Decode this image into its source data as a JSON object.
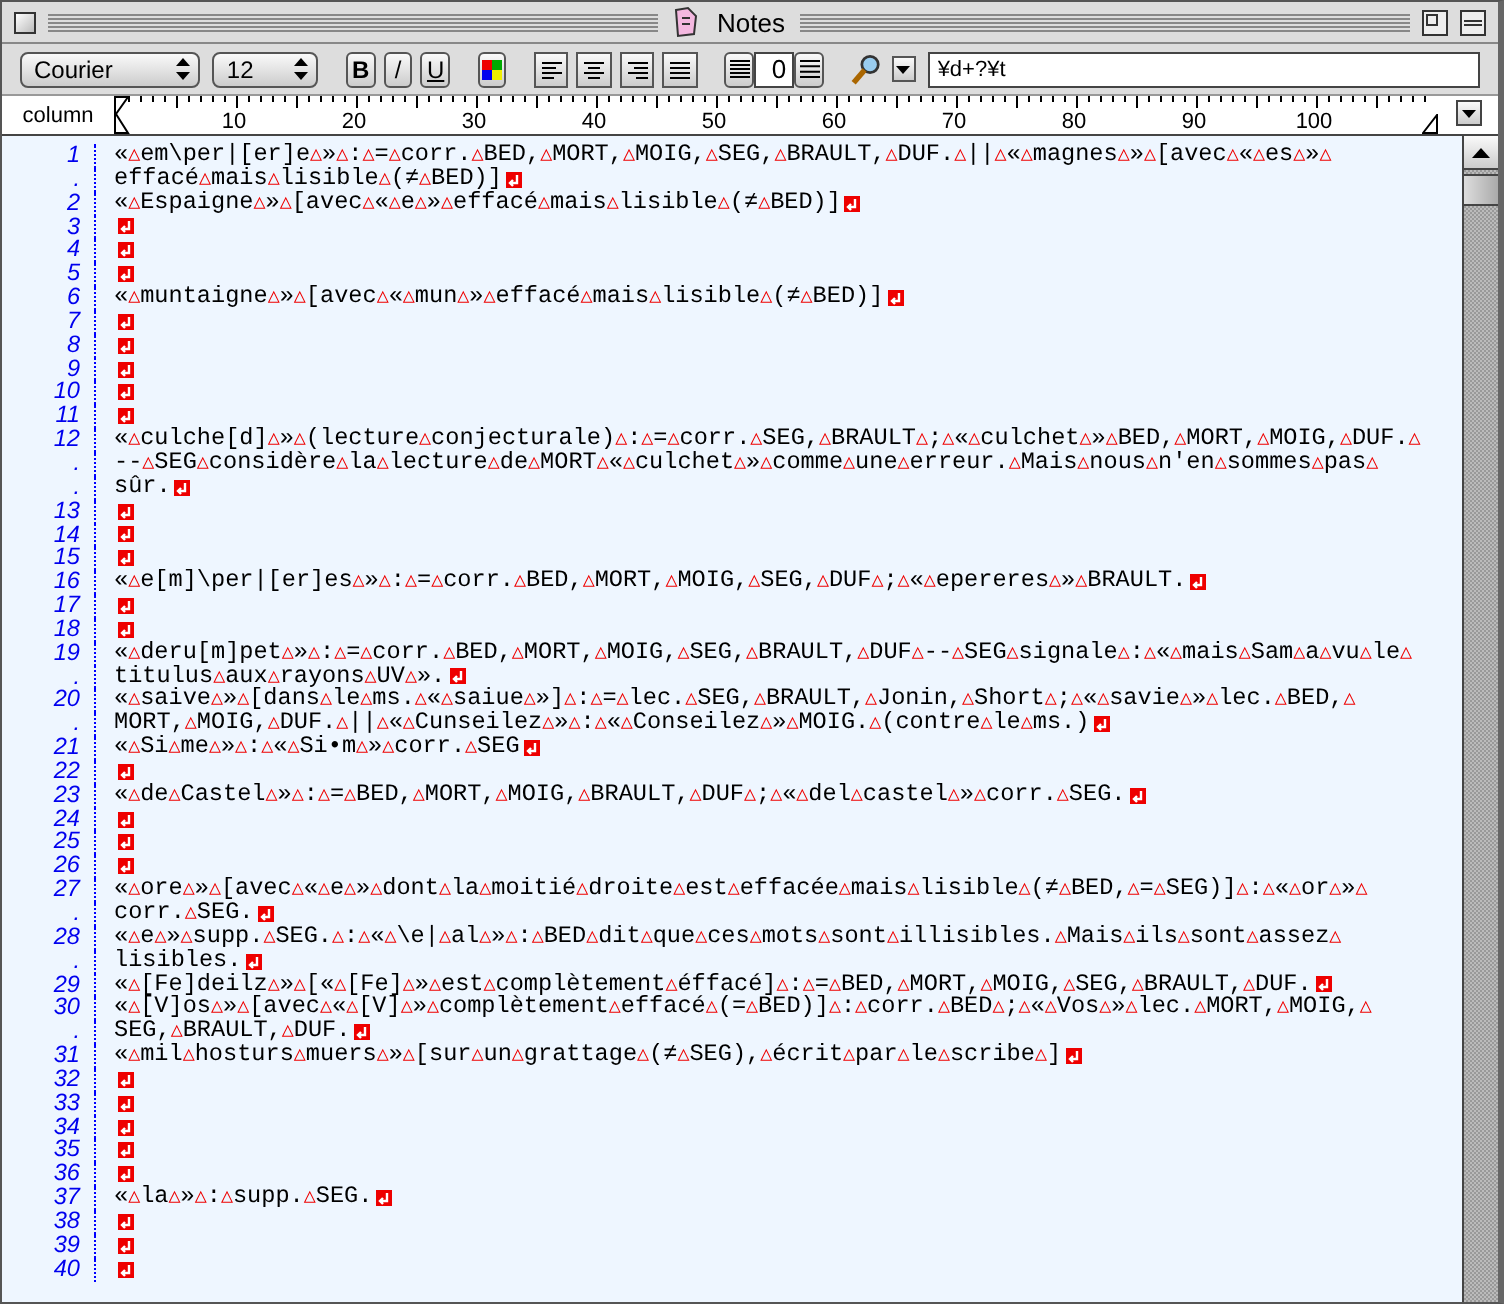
{
  "window": {
    "title": "Notes"
  },
  "toolbar": {
    "font": "Courier",
    "size": "12",
    "style_buttons": [
      {
        "kind": "bold",
        "label": "B"
      },
      {
        "kind": "italic",
        "label": "/"
      },
      {
        "kind": "underline",
        "label": "U"
      }
    ],
    "line_spacing": "0",
    "search": {
      "value": "¥d+?¥t"
    }
  },
  "ruler": {
    "label": "column",
    "ticks": [
      "10",
      "20",
      "30",
      "40",
      "50",
      "60",
      "70",
      "80",
      "90",
      "100"
    ]
  },
  "paragraphs": [
    {
      "lines": [
        {
          "gutter": "1",
          "text": "«△em\\per|[er]e△»△:△=△corr.△BED,△MORT,△MOIG,△SEG,△BRAULT,△DUF.△||△«△magnes△»△[avec△«△es△»△"
        },
        {
          "gutter": ".",
          "text": "effacé△mais△lisible△(≠△BED)]"
        }
      ]
    },
    {
      "lines": [
        {
          "gutter": "2",
          "text": "«△Espaigne△»△[avec△«△e△»△effacé△mais△lisible△(≠△BED)]"
        }
      ]
    },
    {
      "lines": [
        {
          "gutter": "3"
        }
      ]
    },
    {
      "lines": [
        {
          "gutter": "4"
        }
      ]
    },
    {
      "lines": [
        {
          "gutter": "5"
        }
      ]
    },
    {
      "lines": [
        {
          "gutter": "6",
          "text": "«△muntaigne△»△[avec△«△mun△»△effacé△mais△lisible△(≠△BED)]"
        }
      ]
    },
    {
      "lines": [
        {
          "gutter": "7"
        }
      ]
    },
    {
      "lines": [
        {
          "gutter": "8"
        }
      ]
    },
    {
      "lines": [
        {
          "gutter": "9"
        }
      ]
    },
    {
      "lines": [
        {
          "gutter": "10"
        }
      ]
    },
    {
      "lines": [
        {
          "gutter": "11"
        }
      ]
    },
    {
      "lines": [
        {
          "gutter": "12",
          "text": "«△culche[d]△»△(lecture△conjecturale)△:△=△corr.△SEG,△BRAULT△;△«△culchet△»△BED,△MORT,△MOIG,△DUF.△"
        },
        {
          "gutter": ".",
          "text": "--△SEG△considère△la△lecture△de△MORT△«△culchet△»△comme△une△erreur.△Mais△nous△n'en△sommes△pas△"
        },
        {
          "gutter": ".",
          "text": "sûr."
        }
      ]
    },
    {
      "lines": [
        {
          "gutter": "13"
        }
      ]
    },
    {
      "lines": [
        {
          "gutter": "14"
        }
      ]
    },
    {
      "lines": [
        {
          "gutter": "15"
        }
      ]
    },
    {
      "lines": [
        {
          "gutter": "16",
          "text": "«△e[m]\\per|[er]es△»△:△=△corr.△BED,△MORT,△MOIG,△SEG,△DUF△;△«△epereres△»△BRAULT."
        }
      ]
    },
    {
      "lines": [
        {
          "gutter": "17"
        }
      ]
    },
    {
      "lines": [
        {
          "gutter": "18"
        }
      ]
    },
    {
      "lines": [
        {
          "gutter": "19",
          "text": "«△deru[m]pet△»△:△=△corr.△BED,△MORT,△MOIG,△SEG,△BRAULT,△DUF△--△SEG△signale△:△«△mais△Sam△a△vu△le△"
        },
        {
          "gutter": ".",
          "text": "titulus△aux△rayons△UV△»."
        }
      ]
    },
    {
      "lines": [
        {
          "gutter": "20",
          "text": "«△saive△»△[dans△le△ms.△«△saiue△»]△:△=△lec.△SEG,△BRAULT,△Jonin,△Short△;△«△savie△»△lec.△BED,△"
        },
        {
          "gutter": ".",
          "text": "MORT,△MOIG,△DUF.△||△«△Cunseilez△»△:△«△Conseilez△»△MOIG.△(contre△le△ms.)"
        }
      ]
    },
    {
      "lines": [
        {
          "gutter": "21",
          "text": "«△Si△me△»△:△«△Si•m△»△corr.△SEG"
        }
      ]
    },
    {
      "lines": [
        {
          "gutter": "22"
        }
      ]
    },
    {
      "lines": [
        {
          "gutter": "23",
          "text": "«△de△Castel△»△:△=△BED,△MORT,△MOIG,△BRAULT,△DUF△;△«△del△castel△»△corr.△SEG."
        }
      ]
    },
    {
      "lines": [
        {
          "gutter": "24"
        }
      ]
    },
    {
      "lines": [
        {
          "gutter": "25"
        }
      ]
    },
    {
      "lines": [
        {
          "gutter": "26"
        }
      ]
    },
    {
      "lines": [
        {
          "gutter": "27",
          "text": "«△ore△»△[avec△«△e△»△dont△la△moitié△droite△est△effacée△mais△lisible△(≠△BED,△=△SEG)]△:△«△or△»△"
        },
        {
          "gutter": ".",
          "text": "corr.△SEG."
        }
      ]
    },
    {
      "lines": [
        {
          "gutter": "28",
          "text": "«△e△»△supp.△SEG.△:△«△\\e|△al△»△:△BED△dit△que△ces△mots△sont△illisibles.△Mais△ils△sont△assez△"
        },
        {
          "gutter": ".",
          "text": "lisibles."
        }
      ]
    },
    {
      "lines": [
        {
          "gutter": "29",
          "text": "«△[Fe]deilz△»△[«△[Fe]△»△est△complètement△éffacé]△:△=△BED,△MORT,△MOIG,△SEG,△BRAULT,△DUF."
        }
      ]
    },
    {
      "lines": [
        {
          "gutter": "30",
          "text": "«△[V]os△»△[avec△«△[V]△»△complètement△effacé△(=△BED)]△:△corr.△BED△;△«△Vos△»△lec.△MORT,△MOIG,△"
        },
        {
          "gutter": ".",
          "text": "SEG,△BRAULT,△DUF."
        }
      ]
    },
    {
      "lines": [
        {
          "gutter": "31",
          "text": "«△mil△hosturs△muers△»△[sur△un△grattage△(≠△SEG),△écrit△par△le△scribe△]"
        }
      ]
    },
    {
      "lines": [
        {
          "gutter": "32"
        }
      ]
    },
    {
      "lines": [
        {
          "gutter": "33"
        }
      ]
    },
    {
      "lines": [
        {
          "gutter": "34"
        }
      ]
    },
    {
      "lines": [
        {
          "gutter": "35"
        }
      ]
    },
    {
      "lines": [
        {
          "gutter": "36"
        }
      ]
    },
    {
      "lines": [
        {
          "gutter": "37",
          "text": "«△la△»△:△supp.△SEG."
        }
      ]
    },
    {
      "lines": [
        {
          "gutter": "38"
        }
      ]
    },
    {
      "lines": [
        {
          "gutter": "39"
        }
      ]
    },
    {
      "lines": [
        {
          "gutter": "40"
        }
      ]
    }
  ]
}
